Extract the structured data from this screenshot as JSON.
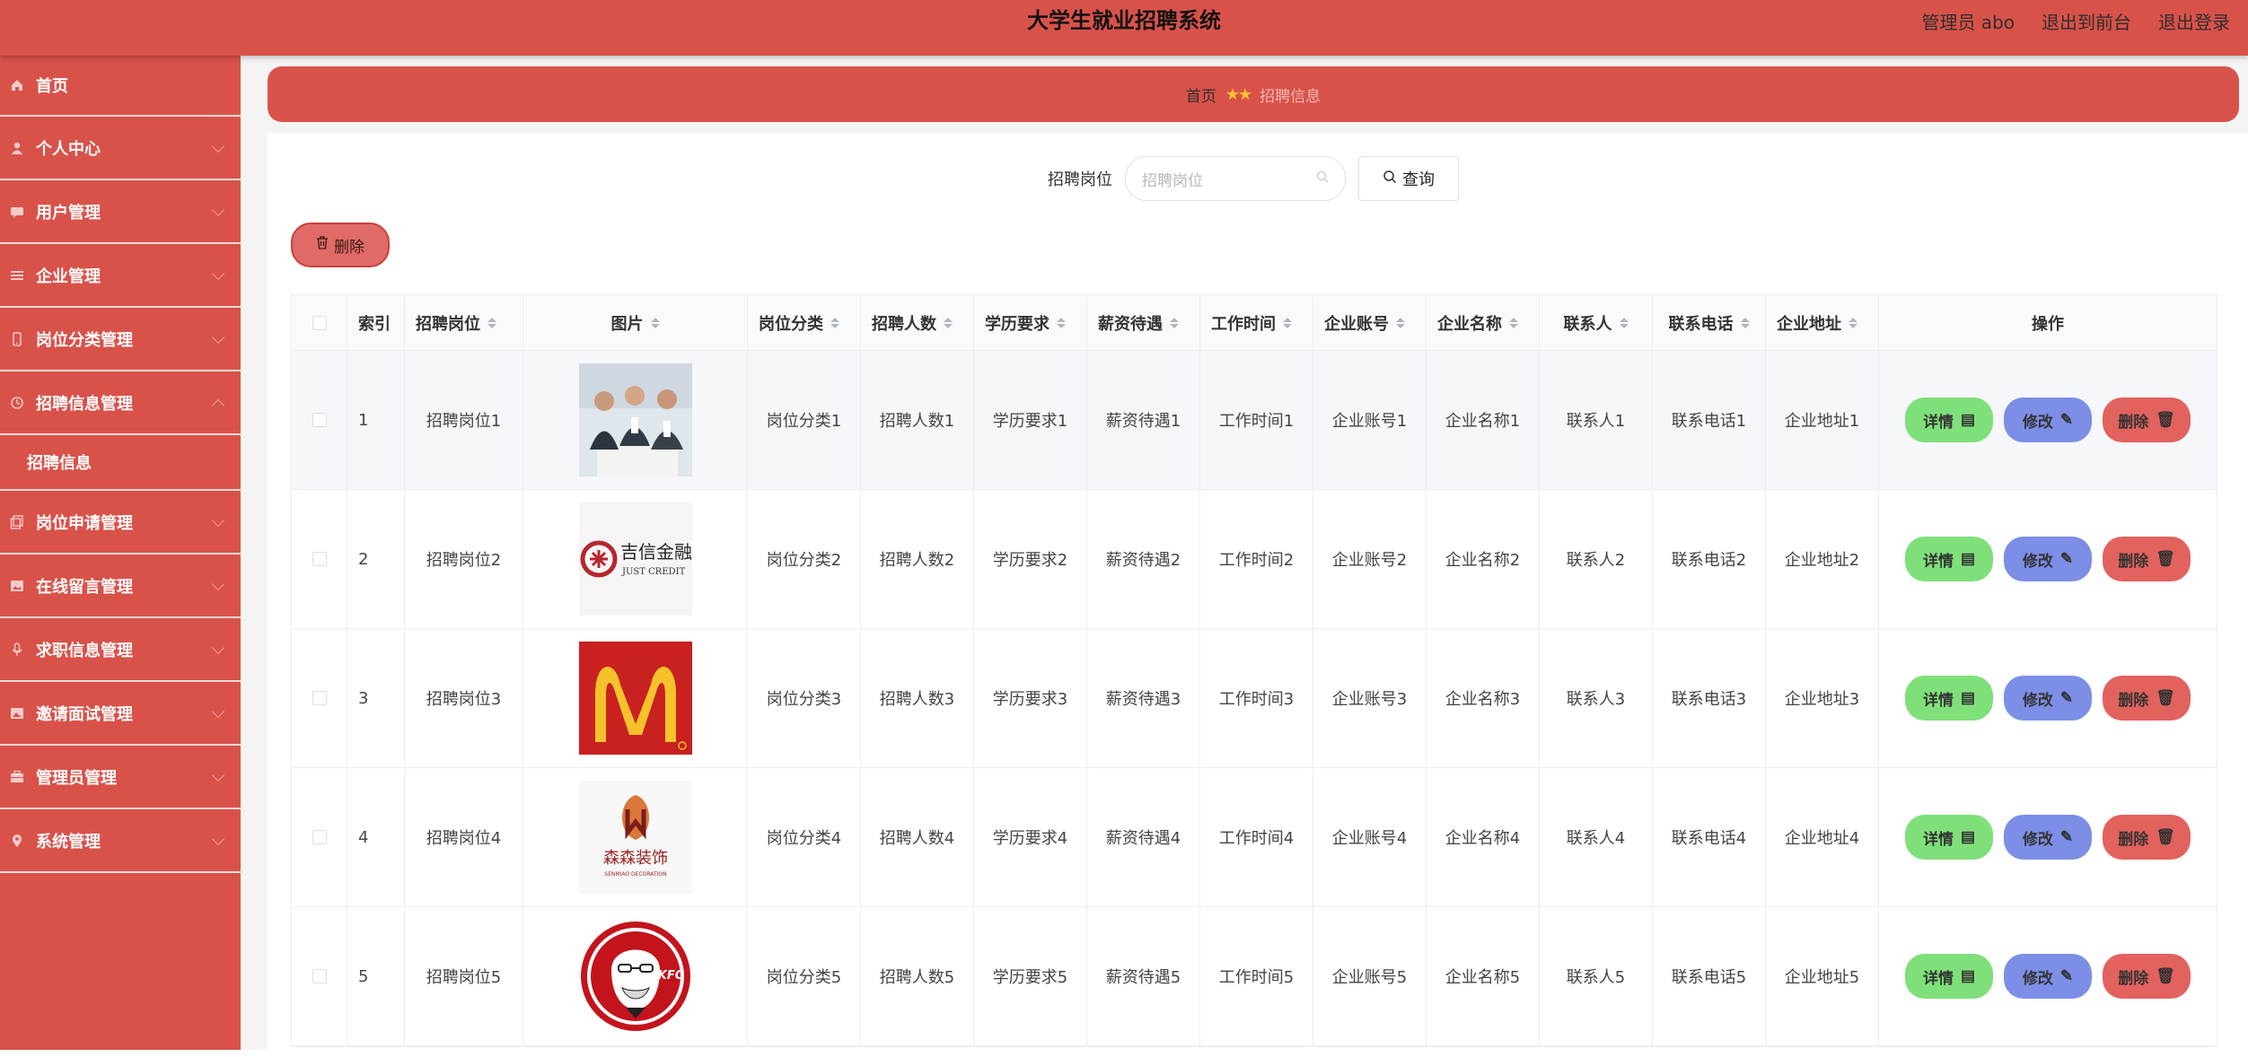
{
  "header": {
    "title": "大学生就业招聘系统",
    "user_label": "管理员 abo",
    "front_link": "退出到前台",
    "logout_link": "退出登录"
  },
  "sidebar": {
    "items": [
      {
        "label": "首页",
        "icon": "home-icon"
      },
      {
        "label": "个人中心",
        "icon": "user-icon"
      },
      {
        "label": "用户管理",
        "icon": "chat-icon"
      },
      {
        "label": "企业管理",
        "icon": "list-icon"
      },
      {
        "label": "岗位分类管理",
        "icon": "phone-icon"
      },
      {
        "label": "招聘信息管理",
        "icon": "clock-icon",
        "expanded": true,
        "sub": [
          "招聘信息"
        ]
      },
      {
        "label": "岗位申请管理",
        "icon": "copy-icon"
      },
      {
        "label": "在线留言管理",
        "icon": "image-icon"
      },
      {
        "label": "求职信息管理",
        "icon": "mic-icon"
      },
      {
        "label": "邀请面试管理",
        "icon": "picture-icon"
      },
      {
        "label": "管理员管理",
        "icon": "briefcase-icon"
      },
      {
        "label": "系统管理",
        "icon": "location-icon"
      }
    ]
  },
  "breadcrumb": {
    "home": "首页",
    "separator": "★★",
    "current": "招聘信息"
  },
  "search": {
    "label": "招聘岗位",
    "placeholder": "招聘岗位",
    "query_button": "查询"
  },
  "bulk_delete_label": "删除",
  "table": {
    "columns": [
      "索引",
      "招聘岗位",
      "图片",
      "岗位分类",
      "招聘人数",
      "学历要求",
      "薪资待遇",
      "工作时间",
      "企业账号",
      "企业名称",
      "联系人",
      "联系电话",
      "企业地址",
      "操作"
    ],
    "actions": {
      "detail": "详情",
      "edit": "修改",
      "delete": "删除"
    },
    "rows": [
      {
        "index": "1",
        "post": "招聘岗位1",
        "image": "meeting-photo",
        "category": "岗位分类1",
        "count": "招聘人数1",
        "edu": "学历要求1",
        "salary": "薪资待遇1",
        "time": "工作时间1",
        "account": "企业账号1",
        "company": "企业名称1",
        "contact": "联系人1",
        "phone": "联系电话1",
        "address": "企业地址1"
      },
      {
        "index": "2",
        "post": "招聘岗位2",
        "image": "jixin-logo",
        "logo_text": "吉信金融",
        "logo_sub": "JUST CREDIT",
        "category": "岗位分类2",
        "count": "招聘人数2",
        "edu": "学历要求2",
        "salary": "薪资待遇2",
        "time": "工作时间2",
        "account": "企业账号2",
        "company": "企业名称2",
        "contact": "联系人2",
        "phone": "联系电话2",
        "address": "企业地址2"
      },
      {
        "index": "3",
        "post": "招聘岗位3",
        "image": "mcdonalds-logo",
        "category": "岗位分类3",
        "count": "招聘人数3",
        "edu": "学历要求3",
        "salary": "薪资待遇3",
        "time": "工作时间3",
        "account": "企业账号3",
        "company": "企业名称3",
        "contact": "联系人3",
        "phone": "联系电话3",
        "address": "企业地址3"
      },
      {
        "index": "4",
        "post": "招聘岗位4",
        "image": "senmiao-logo",
        "logo_text": "森森装饰",
        "logo_sub": "SENMIAO DECORATION",
        "category": "岗位分类4",
        "count": "招聘人数4",
        "edu": "学历要求4",
        "salary": "薪资待遇4",
        "time": "工作时间4",
        "account": "企业账号4",
        "company": "企业名称4",
        "contact": "联系人4",
        "phone": "联系电话4",
        "address": "企业地址4"
      },
      {
        "index": "5",
        "post": "招聘岗位5",
        "image": "kfc-logo",
        "logo_text": "KFC",
        "category": "岗位分类5",
        "count": "招聘人数5",
        "edu": "学历要求5",
        "salary": "薪资待遇5",
        "time": "工作时间5",
        "account": "企业账号5",
        "company": "企业名称5",
        "contact": "联系人5",
        "phone": "联系电话5",
        "address": "企业地址5"
      }
    ]
  },
  "colors": {
    "primary": "#d9524a",
    "detail_btn": "#7fe07a",
    "edit_btn": "#7c8ee6",
    "delete_btn": "#e2625e"
  }
}
